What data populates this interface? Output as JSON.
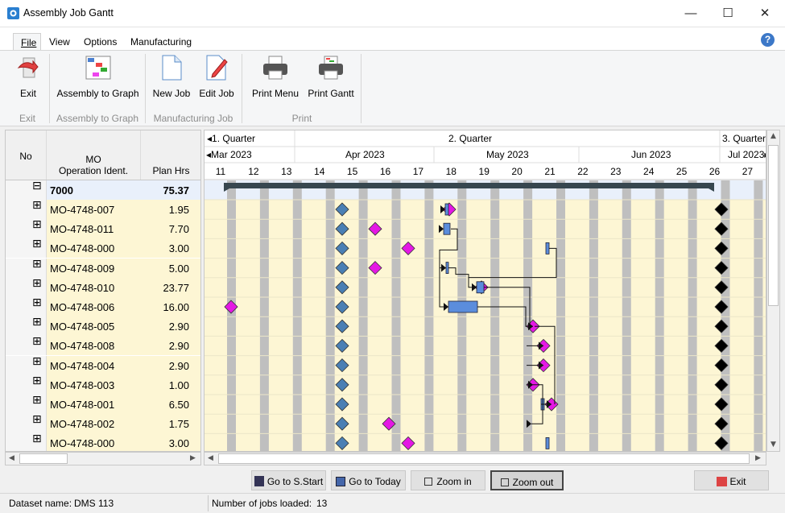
{
  "window": {
    "title": "Assembly Job Gantt",
    "minimize": "—",
    "maximize": "☐",
    "close": "✕"
  },
  "menu": {
    "file": "File",
    "view": "View",
    "options": "Options",
    "manufacturing": "Manufacturing",
    "help": "?"
  },
  "ribbon": {
    "exit": "Exit",
    "assembly_to_graph": "Assembly to Graph",
    "new_job": "New Job",
    "edit_job": "Edit Job",
    "print_menu": "Print Menu",
    "print_gantt": "Print Gantt",
    "groups": {
      "exit": "Exit",
      "assembly": "Assembly to Graph",
      "manufacturing": "Manufacturing Job",
      "print": "Print"
    }
  },
  "table": {
    "headers": {
      "no": "No",
      "mo_line1": "MO",
      "mo_line2": "Operation Ident.",
      "plan_hrs": "Plan Hrs"
    },
    "parent": {
      "expander": "⊟",
      "id": "7000",
      "hrs": "75.37"
    },
    "rows": [
      {
        "expander": "⊞",
        "id": "MO-4748-007",
        "hrs": "1.95"
      },
      {
        "expander": "⊞",
        "id": "MO-4748-011",
        "hrs": "7.70"
      },
      {
        "expander": "⊞",
        "id": "MO-4748-000",
        "hrs": "3.00"
      },
      {
        "expander": "⊞",
        "id": "MO-4748-009",
        "hrs": "5.00"
      },
      {
        "expander": "⊞",
        "id": "MO-4748-010",
        "hrs": "23.77"
      },
      {
        "expander": "⊞",
        "id": "MO-4748-006",
        "hrs": "16.00"
      },
      {
        "expander": "⊞",
        "id": "MO-4748-005",
        "hrs": "2.90"
      },
      {
        "expander": "⊞",
        "id": "MO-4748-008",
        "hrs": "2.90"
      },
      {
        "expander": "⊞",
        "id": "MO-4748-004",
        "hrs": "2.90"
      },
      {
        "expander": "⊞",
        "id": "MO-4748-003",
        "hrs": "1.00"
      },
      {
        "expander": "⊞",
        "id": "MO-4748-001",
        "hrs": "6.50"
      },
      {
        "expander": "⊞",
        "id": "MO-4748-002",
        "hrs": "1.75"
      },
      {
        "expander": "⊞",
        "id": "MO-4748-000",
        "hrs": "3.00"
      }
    ]
  },
  "gantt": {
    "quarters": [
      "◂1. Quarter",
      "2. Quarter",
      "3. Quarter▸"
    ],
    "months": [
      "◂Mar 2023",
      "Apr 2023",
      "May 2023",
      "Jun 2023",
      "Jul 2023▸"
    ],
    "weeks": [
      "11",
      "12",
      "13",
      "14",
      "15",
      "16",
      "17",
      "18",
      "19",
      "20",
      "21",
      "22",
      "23",
      "24",
      "25",
      "26",
      "27"
    ],
    "milestone_colors": {
      "start": "#4a7fb4",
      "due": "#e418e4",
      "end": "#000000",
      "bar": "#5b8ddc"
    }
  },
  "buttons": {
    "go_start": "Go to S.Start",
    "go_today": "Go to Today",
    "zoom_in": "Zoom in",
    "zoom_out": "Zoom out",
    "exit": "Exit"
  },
  "status": {
    "dataset_label": "Dataset name:",
    "dataset_value": "DMS 113",
    "jobs_label": "Number of jobs loaded:",
    "jobs_value": "13"
  }
}
